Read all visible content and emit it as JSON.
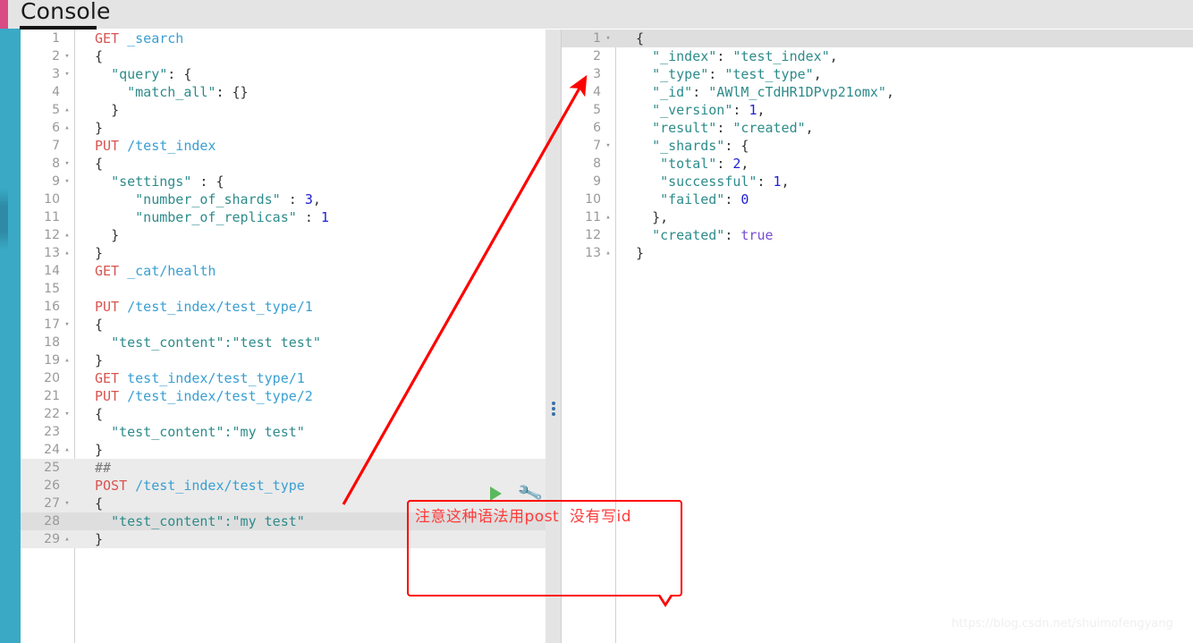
{
  "header": {
    "tab_label": "Console"
  },
  "icons": {
    "play": "play-icon",
    "wrench": "wrench-icon",
    "splitter": "splitter-handle-icon",
    "arrow": "red-arrow-annotation"
  },
  "colors": {
    "accent_pink": "#d94b85",
    "accent_teal": "#3aa9c6",
    "method": "#d9534f",
    "url": "#3a9fd1",
    "string": "#2e8b8b",
    "number": "#2020d0",
    "boolean": "#7a4ed1",
    "annotation_red": "#ff0000",
    "play_green": "#5cb85c"
  },
  "editor": {
    "name": "request-editor",
    "lines": [
      {
        "n": "1",
        "fold": "",
        "html": "<span class='m'>GET</span> <span class='u'>_search</span>"
      },
      {
        "n": "2",
        "fold": "▾",
        "html": "<span class='p'>{</span>"
      },
      {
        "n": "3",
        "fold": "▾",
        "html": "  <span class='k'>\"query\"</span><span class='p'>: {</span>"
      },
      {
        "n": "4",
        "fold": "",
        "html": "    <span class='k'>\"match_all\"</span><span class='p'>: {}</span>"
      },
      {
        "n": "5",
        "fold": "▴",
        "html": "  <span class='p'>}</span>"
      },
      {
        "n": "6",
        "fold": "▴",
        "html": "<span class='p'>}</span>"
      },
      {
        "n": "7",
        "fold": "",
        "html": "<span class='m'>PUT</span> <span class='u'>/test_index</span>"
      },
      {
        "n": "8",
        "fold": "▾",
        "html": "<span class='p'>{</span>"
      },
      {
        "n": "9",
        "fold": "▾",
        "html": "  <span class='k'>\"settings\"</span> <span class='p'>: {</span>"
      },
      {
        "n": "10",
        "fold": "",
        "html": "     <span class='k'>\"number_of_shards\"</span> <span class='p'>:</span> <span class='n'>3</span><span class='p'>,</span>"
      },
      {
        "n": "11",
        "fold": "",
        "html": "     <span class='k'>\"number_of_replicas\"</span> <span class='p'>:</span> <span class='n'>1</span>"
      },
      {
        "n": "12",
        "fold": "▴",
        "html": "  <span class='p'>}</span>"
      },
      {
        "n": "13",
        "fold": "▴",
        "html": "<span class='p'>}</span>"
      },
      {
        "n": "14",
        "fold": "",
        "html": "<span class='m'>GET</span> <span class='u'>_cat/health</span>"
      },
      {
        "n": "15",
        "fold": "",
        "html": ""
      },
      {
        "n": "16",
        "fold": "",
        "html": "<span class='m'>PUT</span> <span class='u'>/test_index/test_type/1</span>"
      },
      {
        "n": "17",
        "fold": "▾",
        "html": "<span class='p'>{</span>"
      },
      {
        "n": "18",
        "fold": "",
        "html": "  <span class='k'>\"test_content\":\"test test\"</span>"
      },
      {
        "n": "19",
        "fold": "▴",
        "html": "<span class='p'>}</span>"
      },
      {
        "n": "20",
        "fold": "",
        "html": "<span class='m'>GET</span> <span class='u'>test_index/test_type/1</span>"
      },
      {
        "n": "21",
        "fold": "",
        "html": "<span class='m'>PUT</span> <span class='u'>/test_index/test_type/2</span>"
      },
      {
        "n": "22",
        "fold": "▾",
        "html": "<span class='p'>{</span>"
      },
      {
        "n": "23",
        "fold": "",
        "html": "  <span class='k'>\"test_content\":\"my test\"</span>"
      },
      {
        "n": "24",
        "fold": "▴",
        "html": "<span class='p'>}</span>"
      },
      {
        "n": "25",
        "fold": "",
        "html": "<span class='c'>##</span>",
        "hl": "hl"
      },
      {
        "n": "26",
        "fold": "",
        "html": "<span class='m'>POST</span> <span class='u'>/test_index/test_type</span>",
        "hl": "hl"
      },
      {
        "n": "27",
        "fold": "▾",
        "html": "<span class='p'>{</span>",
        "hl": "hl"
      },
      {
        "n": "28",
        "fold": "",
        "html": "  <span class='k'>\"test_content\":\"my test\"</span>",
        "hl": "cur"
      },
      {
        "n": "29",
        "fold": "▴",
        "html": "<span class='p'>}</span>",
        "hl": "hl"
      }
    ],
    "plain_text": [
      "GET _search",
      "{",
      "  \"query\": {",
      "    \"match_all\": {}",
      "  }",
      "}",
      "PUT /test_index",
      "{",
      "  \"settings\" : {",
      "     \"number_of_shards\" : 3,",
      "     \"number_of_replicas\" : 1",
      "  }",
      "}",
      "GET _cat/health",
      "",
      "PUT /test_index/test_type/1",
      "{",
      "  \"test_content\":\"test test\"",
      "}",
      "GET test_index/test_type/1",
      "PUT /test_index/test_type/2",
      "{",
      "  \"test_content\":\"my test\"",
      "}",
      "##",
      "POST /test_index/test_type",
      "{",
      "  \"test_content\":\"my test\"",
      "}"
    ]
  },
  "response": {
    "name": "response-viewer",
    "lines": [
      {
        "n": "1",
        "fold": "▾",
        "html": "<span class='p'>{</span>",
        "hl": "cur"
      },
      {
        "n": "2",
        "fold": "",
        "html": "  <span class='k'>\"_index\"</span><span class='p'>:</span> <span class='k'>\"test_index\"</span><span class='p'>,</span>"
      },
      {
        "n": "3",
        "fold": "",
        "html": "  <span class='k'>\"_type\"</span><span class='p'>:</span> <span class='k'>\"test_type\"</span><span class='p'>,</span>"
      },
      {
        "n": "4",
        "fold": "",
        "html": "  <span class='k'>\"_id\"</span><span class='p'>:</span> <span class='k'>\"AWlM_cTdHR1DPvp21omx\"</span><span class='p'>,</span>"
      },
      {
        "n": "5",
        "fold": "",
        "html": "  <span class='k'>\"_version\"</span><span class='p'>:</span> <span class='n'>1</span><span class='p'>,</span>"
      },
      {
        "n": "6",
        "fold": "",
        "html": "  <span class='k'>\"result\"</span><span class='p'>:</span> <span class='k'>\"created\"</span><span class='p'>,</span>"
      },
      {
        "n": "7",
        "fold": "▾",
        "html": "  <span class='k'>\"_shards\"</span><span class='p'>: {</span>"
      },
      {
        "n": "8",
        "fold": "",
        "html": "   <span class='k'>\"total\"</span><span class='p'>:</span> <span class='n'>2</span><span class='p'>,</span>"
      },
      {
        "n": "9",
        "fold": "",
        "html": "   <span class='k'>\"successful\"</span><span class='p'>:</span> <span class='n'>1</span><span class='p'>,</span>"
      },
      {
        "n": "10",
        "fold": "",
        "html": "   <span class='k'>\"failed\"</span><span class='p'>:</span> <span class='n'>0</span>"
      },
      {
        "n": "11",
        "fold": "▴",
        "html": "  <span class='p'>},</span>"
      },
      {
        "n": "12",
        "fold": "",
        "html": "  <span class='k'>\"created\"</span><span class='p'>:</span> <span class='b'>true</span>"
      },
      {
        "n": "13",
        "fold": "▴",
        "html": "<span class='p'>}</span>"
      }
    ],
    "json": {
      "_index": "test_index",
      "_type": "test_type",
      "_id": "AWlM_cTdHR1DPvp21omx",
      "_version": 1,
      "result": "created",
      "_shards": {
        "total": 2,
        "successful": 1,
        "failed": 0
      },
      "created": true
    }
  },
  "annotation": {
    "text": "注意这种语法用post  没有写id",
    "border_color": "#ff0000"
  },
  "watermark": {
    "text": "https://blog.csdn.net/shuimofengyang"
  }
}
